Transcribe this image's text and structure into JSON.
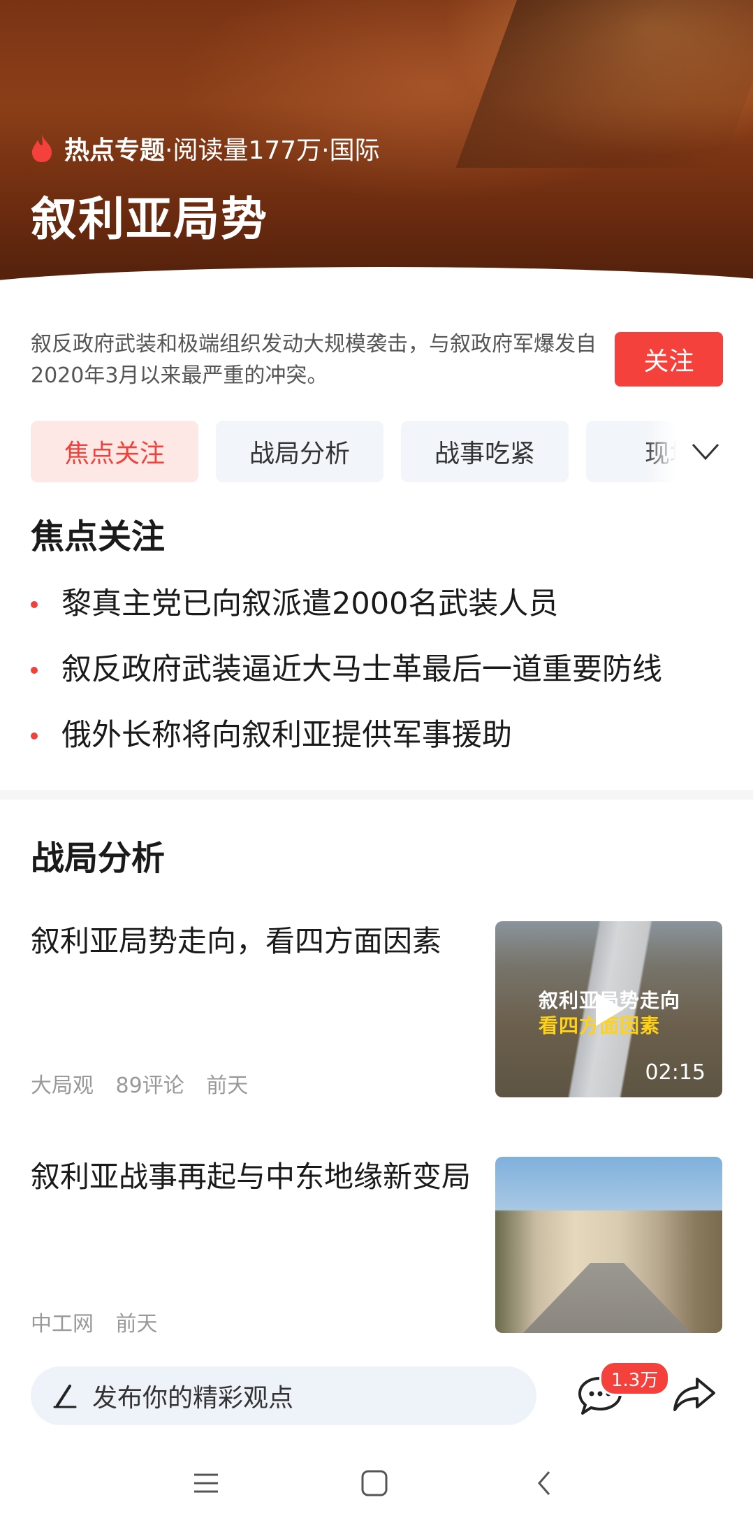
{
  "banner": {
    "meta_strong": "热点专题",
    "meta_rest": "·阅读量177万·国际",
    "title": "叙利亚局势"
  },
  "intro": {
    "description": "叙反政府武装和极端组织发动大规模袭击，与叙政府军爆发自2020年3月以来最严重的冲突。",
    "follow_label": "关注"
  },
  "tabs": [
    {
      "label": "焦点关注",
      "active": true
    },
    {
      "label": "战局分析",
      "active": false
    },
    {
      "label": "战事吃紧",
      "active": false
    },
    {
      "label": "现场",
      "active": false
    }
  ],
  "focus": {
    "heading": "焦点关注",
    "items": [
      "黎真主党已向叙派遣2000名武装人员",
      "叙反政府武装逼近大马士革最后一道重要防线",
      "俄外长称将向叙利亚提供军事援助"
    ]
  },
  "analysis": {
    "heading": "战局分析",
    "articles": [
      {
        "title": "叙利亚局势走向，看四方面因素",
        "source": "大局观",
        "comments": "89评论",
        "time": "前天",
        "thumb_caption_1": "叙利亚局势走向",
        "thumb_caption_2": "看四方面因素",
        "duration": "02:15"
      },
      {
        "title": "叙利亚战事再起与中东地缘新变局",
        "source": "中工网",
        "time": "前天"
      }
    ]
  },
  "bottom_bar": {
    "comment_placeholder": "发布你的精彩观点",
    "comment_count": "1.3万"
  },
  "colors": {
    "accent": "#f5413b",
    "tab_active_bg": "#fde8e6",
    "tab_bg": "#f2f5f9"
  },
  "icons": [
    "flame-icon",
    "chevron-down-icon",
    "play-icon",
    "pen-icon",
    "comment-icon",
    "share-icon",
    "menu-icon",
    "home-icon",
    "back-icon"
  ]
}
